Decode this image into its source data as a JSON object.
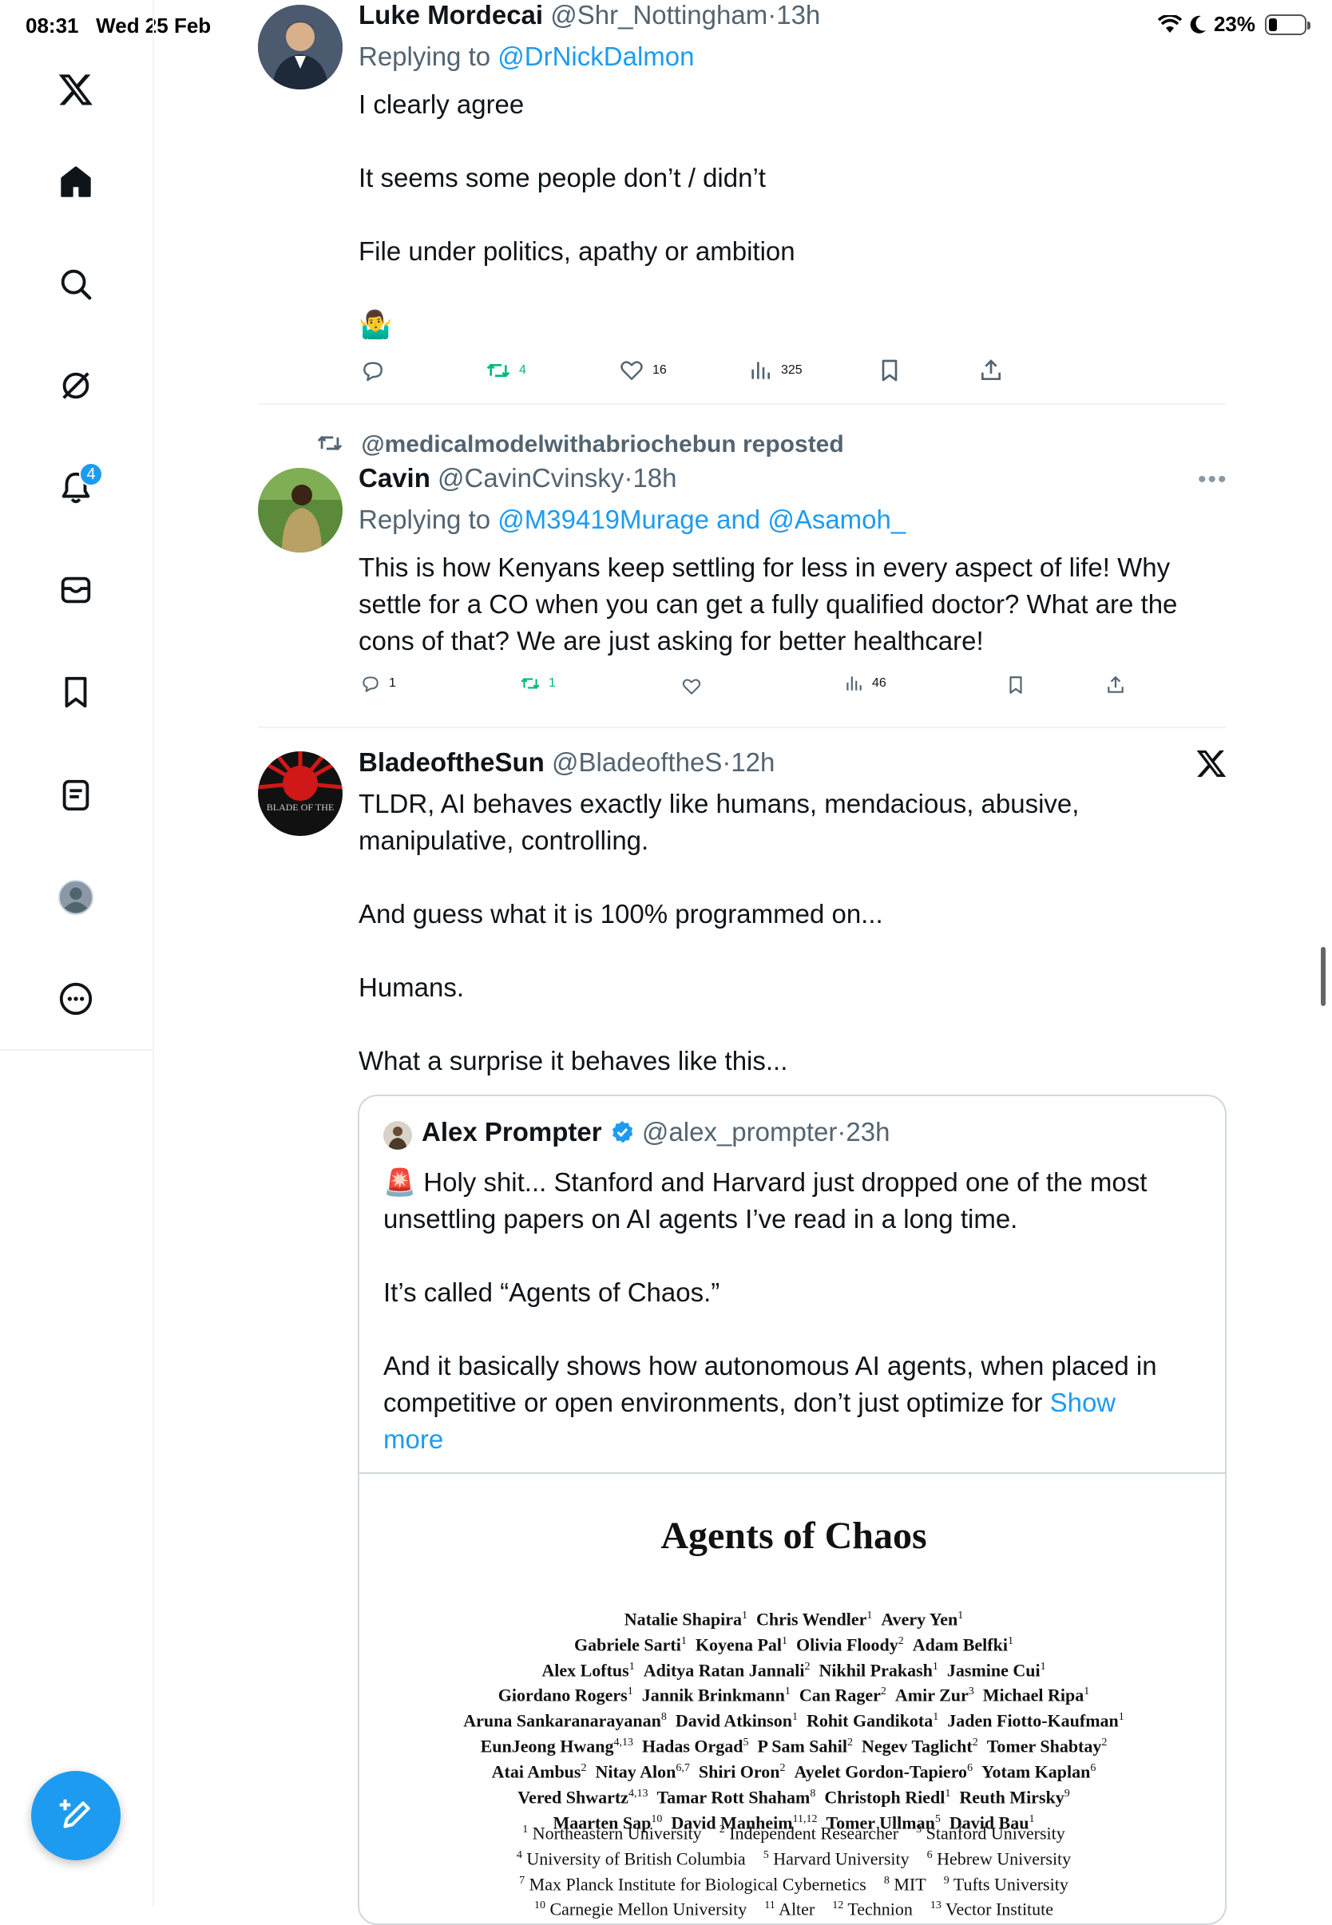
{
  "status_bar": {
    "time": "08:31",
    "date": "Wed 25 Feb",
    "battery": "23%"
  },
  "sidebar": {
    "notification_count": "4"
  },
  "tweet1": {
    "name": "Luke Mordecai",
    "handle": "@Shr_Nottingham",
    "time": "13h",
    "replying_label": "Replying to",
    "replying_to": "@DrNickDalmon",
    "text1": "I clearly agree",
    "text2": "It seems some people don’t / didn’t",
    "text3": "File under politics, apathy or ambition",
    "emoji": "🤷‍♂️",
    "retweets": "4",
    "likes": "16",
    "views": "325"
  },
  "tweet2": {
    "repost_label": "@medicalmodelwithabriochebun reposted",
    "name": "Cavin",
    "handle": "@CavinCvinsky",
    "time": "18h",
    "replying_label": "Replying to",
    "replying_to": "@M39419Murage and @Asamoh_",
    "line1": "This is how Kenyans keep settling for less in every aspect of life! Why",
    "line2": "settle for a CO when you can get a fully qualified doctor? What are the",
    "line3": "cons of that? We are just asking for better healthcare!",
    "replies": "1",
    "retweets": "1",
    "views": "46"
  },
  "tweet3": {
    "name": "BladeoftheSun",
    "handle": "@BladeoftheS",
    "time": "12h",
    "line1": "TLDR, AI behaves exactly like humans, mendacious, abusive,",
    "line2": "manipulative, controlling.",
    "line3": "And guess what it is 100% programmed on...",
    "line4": "Humans.",
    "line5": "What a surprise it behaves like this...",
    "avatar_text": "BLADE OF THE"
  },
  "quote": {
    "name": "Alex Prompter",
    "handle": "@alex_prompter",
    "time": "23h",
    "line1": "🚨 Holy shit... Stanford and Harvard just dropped one of the most",
    "line2": "unsettling papers on AI agents I’ve read in a long time.",
    "line3": "It’s called “Agents of Chaos.”",
    "line4": "And it basically shows how autonomous AI agents, when placed in",
    "line5": "competitive or open environments, don’t just optimize for",
    "show_more_1": "Show",
    "show_more_2": "more"
  },
  "paper": {
    "title": "Agents of Chaos",
    "authors": [
      [
        "Natalie Shapira",
        "1",
        "Chris Wendler",
        "1",
        "Avery Yen",
        "1"
      ],
      [
        "Gabriele Sarti",
        "1",
        "Koyena Pal",
        "1",
        "Olivia Floody",
        "2",
        "Adam Belfki",
        "1"
      ],
      [
        "Alex Loftus",
        "1",
        "Aditya Ratan Jannali",
        "2",
        "Nikhil Prakash",
        "1",
        "Jasmine Cui",
        "1"
      ],
      [
        "Giordano Rogers",
        "1",
        "Jannik Brinkmann",
        "1",
        "Can Rager",
        "2",
        "Amir Zur",
        "3",
        "Michael Ripa",
        "1"
      ],
      [
        "Aruna Sankaranarayanan",
        "8",
        "David Atkinson",
        "1",
        "Rohit Gandikota",
        "1",
        "Jaden Fiotto-Kaufman",
        "1"
      ],
      [
        "EunJeong Hwang",
        "4,13",
        "Hadas Orgad",
        "5",
        "P Sam Sahil",
        "2",
        "Negev Taglicht",
        "2",
        "Tomer Shabtay",
        "2"
      ],
      [
        "Atai Ambus",
        "2",
        "Nitay Alon",
        "6,7",
        "Shiri Oron",
        "2",
        "Ayelet Gordon-Tapiero",
        "6",
        "Yotam Kaplan",
        "6"
      ],
      [
        "Vered Shwartz",
        "4,13",
        "Tamar Rott Shaham",
        "8",
        "Christoph Riedl",
        "1",
        "Reuth Mirsky",
        "9"
      ],
      [
        "Maarten Sap",
        "10",
        "David Manheim",
        "11,12",
        "Tomer Ullman",
        "5",
        "David Bau",
        "1"
      ]
    ],
    "affiliations": [
      [
        "1",
        "Northeastern University",
        "2",
        "Independent Researcher",
        "3",
        "Stanford University"
      ],
      [
        "4",
        "University of British Columbia",
        "5",
        "Harvard University",
        "6",
        "Hebrew University"
      ],
      [
        "7",
        "Max Planck Institute for Biological Cybernetics",
        "8",
        "MIT",
        "9",
        "Tufts University"
      ],
      [
        "10",
        "Carnegie Mellon University",
        "11",
        "Alter",
        "12",
        "Technion",
        "13",
        "Vector Institute"
      ]
    ]
  }
}
